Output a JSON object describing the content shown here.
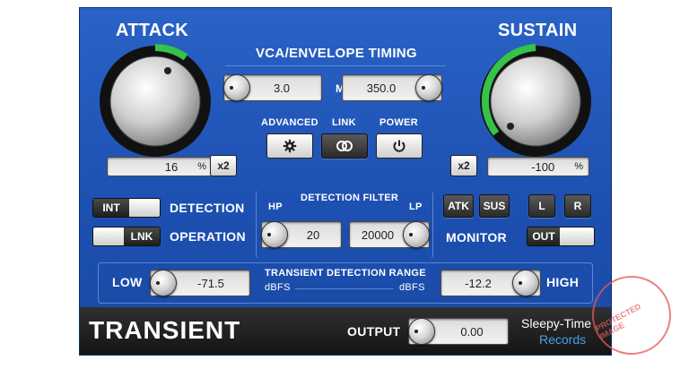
{
  "attack": {
    "title": "ATTACK",
    "percent_value": "16",
    "percent_unit": "%",
    "x2_label": "x2"
  },
  "sustain": {
    "title": "SUSTAIN",
    "percent_value": "-100",
    "percent_unit": "%",
    "x2_label": "x2"
  },
  "vca": {
    "title": "VCA/ENVELOPE TIMING",
    "left_value": "3.0",
    "unit": "MS",
    "right_value": "350.0"
  },
  "controls": {
    "advanced": "ADVANCED",
    "link": "LINK",
    "power": "POWER"
  },
  "detection": {
    "int_label": "INT",
    "detection_label": "DETECTION",
    "lnk_label": "LNK",
    "operation_label": "OPERATION"
  },
  "filter": {
    "title": "DETECTION FILTER",
    "hp_label": "HP",
    "lp_label": "LP",
    "hp_value": "20",
    "lp_value": "20000"
  },
  "monitor": {
    "atk": "ATK",
    "sus": "SUS",
    "l": "L",
    "r": "R",
    "out": "OUT",
    "label": "MONITOR"
  },
  "range": {
    "low_label": "LOW",
    "low_value": "-71.5",
    "title": "TRANSIENT DETECTION RANGE",
    "dbfs_left": "dBFS",
    "dbfs_right": "dBFS",
    "high_value": "-12.2",
    "high_label": "HIGH"
  },
  "footer": {
    "product": "TRANSIENT",
    "output_label": "OUTPUT",
    "output_value": "0.00",
    "brand_line1": "Sleepy-Time",
    "brand_line2": "Records"
  },
  "watermark": {
    "text": "PROTECTED IMAGE"
  },
  "colors": {
    "panel_blue": "#1f55b8",
    "meter_green": "#35c24a",
    "brand_blue": "#4aa0e8",
    "stamp_red": "#e25a5a"
  }
}
